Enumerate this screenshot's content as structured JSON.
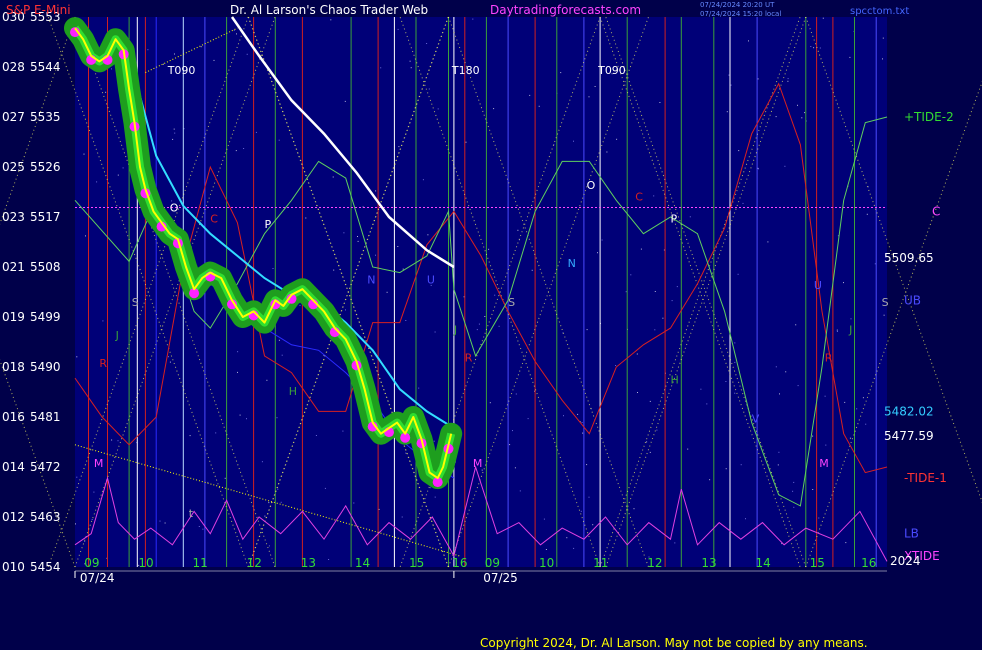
{
  "header": {
    "symbol": "S&P E-Mini",
    "title": "Dr. Al Larson's Chaos Trader Web",
    "site": "Daytradingforecasts.com",
    "stamp_line1": "07/24/2024 20:20 UT",
    "stamp_line2": "07/24/2024 15:20 local",
    "file": "spcctom.txt"
  },
  "footer": {
    "copyright": "Copyright 2024, Dr. Al Larson. May not be copied by any means."
  },
  "colors": {
    "background": "#00004a",
    "plot": "#000078",
    "price": "#ffff00",
    "price_band": "#1e9e1e",
    "price_dots": "#ff22ff",
    "tide_green": "#5fd05f",
    "tide_red": "#d82020",
    "xtide": "#e040e0",
    "cyan_band": "#33ddff",
    "ref_line": "#ff44ff"
  },
  "chart_data": {
    "type": "line",
    "title": "Dr. Al Larson's Chaos Trader Web",
    "instrument": "S&P E-Mini",
    "ylim": [
      5454,
      5553
    ],
    "y_ticks": [
      {
        "left": "030",
        "price": "5553"
      },
      {
        "left": "028",
        "price": "5544"
      },
      {
        "left": "027",
        "price": "5535"
      },
      {
        "left": "025",
        "price": "5526"
      },
      {
        "left": "023",
        "price": "5517"
      },
      {
        "left": "021",
        "price": "5508"
      },
      {
        "left": "019",
        "price": "5499"
      },
      {
        "left": "018",
        "price": "5490"
      },
      {
        "left": "016",
        "price": "5481"
      },
      {
        "left": "014",
        "price": "5472"
      },
      {
        "left": "012",
        "price": "5463"
      },
      {
        "left": "010",
        "price": "5454"
      }
    ],
    "hour_ticks": [
      "09",
      "10",
      "11",
      "12",
      "13",
      "14",
      "15",
      "16",
      "09",
      "10",
      "11",
      "12",
      "13",
      "14",
      "15",
      "16"
    ],
    "date_labels": [
      "07/24",
      "07/25"
    ],
    "year_label": "2024",
    "right_values": [
      "5509.65",
      "5482.02",
      "5477.59"
    ],
    "right_labels": [
      "+TIDE-2",
      "C",
      "UB",
      "-TIDE-1",
      "LB",
      "XTIDE"
    ],
    "reference_line_value": 5518.7,
    "time_markers": [
      "T090",
      "T180",
      "T090"
    ],
    "letter_markers": [
      "O",
      "C",
      "P",
      "S",
      "J",
      "R",
      "H",
      "M",
      "t",
      "O",
      "C",
      "P",
      "N",
      "S",
      "J",
      "R",
      "H",
      "M",
      "S",
      "J",
      "R",
      "M",
      "U",
      "V",
      "N",
      "U"
    ],
    "price_series": [
      {
        "h": 9.0,
        "v": 5551
      },
      {
        "h": 9.15,
        "v": 5549
      },
      {
        "h": 9.3,
        "v": 5546
      },
      {
        "h": 9.45,
        "v": 5545
      },
      {
        "h": 9.6,
        "v": 5546
      },
      {
        "h": 9.75,
        "v": 5549
      },
      {
        "h": 9.9,
        "v": 5547
      },
      {
        "h": 10.0,
        "v": 5540
      },
      {
        "h": 10.1,
        "v": 5534
      },
      {
        "h": 10.2,
        "v": 5526
      },
      {
        "h": 10.3,
        "v": 5522
      },
      {
        "h": 10.45,
        "v": 5518
      },
      {
        "h": 10.6,
        "v": 5516
      },
      {
        "h": 10.75,
        "v": 5514
      },
      {
        "h": 10.9,
        "v": 5513
      },
      {
        "h": 11.05,
        "v": 5508
      },
      {
        "h": 11.2,
        "v": 5504
      },
      {
        "h": 11.35,
        "v": 5506
      },
      {
        "h": 11.5,
        "v": 5507
      },
      {
        "h": 11.7,
        "v": 5506
      },
      {
        "h": 11.9,
        "v": 5502
      },
      {
        "h": 12.1,
        "v": 5499
      },
      {
        "h": 12.3,
        "v": 5500
      },
      {
        "h": 12.5,
        "v": 5498
      },
      {
        "h": 12.7,
        "v": 5502
      },
      {
        "h": 12.85,
        "v": 5501
      },
      {
        "h": 13.0,
        "v": 5503
      },
      {
        "h": 13.2,
        "v": 5504
      },
      {
        "h": 13.4,
        "v": 5502
      },
      {
        "h": 13.6,
        "v": 5500
      },
      {
        "h": 13.8,
        "v": 5497
      },
      {
        "h": 14.0,
        "v": 5495
      },
      {
        "h": 14.2,
        "v": 5491
      },
      {
        "h": 14.35,
        "v": 5486
      },
      {
        "h": 14.5,
        "v": 5480
      },
      {
        "h": 14.65,
        "v": 5478
      },
      {
        "h": 14.8,
        "v": 5479
      },
      {
        "h": 14.95,
        "v": 5480
      },
      {
        "h": 15.1,
        "v": 5478
      },
      {
        "h": 15.25,
        "v": 5481
      },
      {
        "h": 15.4,
        "v": 5477
      },
      {
        "h": 15.55,
        "v": 5471
      },
      {
        "h": 15.7,
        "v": 5470
      },
      {
        "h": 15.8,
        "v": 5472
      },
      {
        "h": 15.9,
        "v": 5476
      },
      {
        "h": 15.95,
        "v": 5478
      }
    ],
    "tide_green_series": [
      {
        "h": 9.0,
        "v": 5520
      },
      {
        "h": 10.0,
        "v": 5509
      },
      {
        "h": 10.5,
        "v": 5520
      },
      {
        "h": 11.0,
        "v": 5506
      },
      {
        "h": 11.2,
        "v": 5500
      },
      {
        "h": 11.5,
        "v": 5497
      },
      {
        "h": 12.0,
        "v": 5505
      },
      {
        "h": 12.5,
        "v": 5514
      },
      {
        "h": 13.0,
        "v": 5520
      },
      {
        "h": 13.5,
        "v": 5527
      },
      {
        "h": 14.0,
        "v": 5524
      },
      {
        "h": 14.5,
        "v": 5508
      },
      {
        "h": 15.0,
        "v": 5507
      },
      {
        "h": 15.5,
        "v": 5510
      },
      {
        "h": 15.9,
        "v": 5518
      },
      {
        "h": 16.0,
        "v": 5504
      },
      {
        "h": 16.4,
        "v": 5492
      },
      {
        "h": 17.0,
        "v": 5502
      },
      {
        "h": 17.5,
        "v": 5518
      },
      {
        "h": 18.0,
        "v": 5527
      },
      {
        "h": 18.5,
        "v": 5527
      },
      {
        "h": 19.0,
        "v": 5520
      },
      {
        "h": 19.5,
        "v": 5514
      },
      {
        "h": 20.0,
        "v": 5517
      },
      {
        "h": 20.5,
        "v": 5514
      },
      {
        "h": 21.0,
        "v": 5500
      },
      {
        "h": 21.5,
        "v": 5480
      },
      {
        "h": 22.0,
        "v": 5467
      },
      {
        "h": 22.4,
        "v": 5465
      },
      {
        "h": 22.8,
        "v": 5490
      },
      {
        "h": 23.2,
        "v": 5520
      },
      {
        "h": 23.6,
        "v": 5534
      },
      {
        "h": 24.0,
        "v": 5535
      }
    ],
    "tide_red_series": [
      {
        "h": 9.0,
        "v": 5488
      },
      {
        "h": 9.5,
        "v": 5481
      },
      {
        "h": 10.0,
        "v": 5476
      },
      {
        "h": 10.5,
        "v": 5481
      },
      {
        "h": 11.0,
        "v": 5508
      },
      {
        "h": 11.5,
        "v": 5526
      },
      {
        "h": 12.0,
        "v": 5516
      },
      {
        "h": 12.5,
        "v": 5492
      },
      {
        "h": 13.0,
        "v": 5489
      },
      {
        "h": 13.5,
        "v": 5482
      },
      {
        "h": 14.0,
        "v": 5482
      },
      {
        "h": 14.5,
        "v": 5498
      },
      {
        "h": 15.0,
        "v": 5498
      },
      {
        "h": 15.5,
        "v": 5512
      },
      {
        "h": 16.0,
        "v": 5518
      },
      {
        "h": 16.5,
        "v": 5510
      },
      {
        "h": 17.0,
        "v": 5500
      },
      {
        "h": 17.5,
        "v": 5491
      },
      {
        "h": 18.0,
        "v": 5484
      },
      {
        "h": 18.5,
        "v": 5478
      },
      {
        "h": 19.0,
        "v": 5490
      },
      {
        "h": 19.5,
        "v": 5494
      },
      {
        "h": 20.0,
        "v": 5497
      },
      {
        "h": 20.5,
        "v": 5505
      },
      {
        "h": 21.0,
        "v": 5515
      },
      {
        "h": 21.5,
        "v": 5532
      },
      {
        "h": 22.0,
        "v": 5541
      },
      {
        "h": 22.4,
        "v": 5530
      },
      {
        "h": 22.8,
        "v": 5500
      },
      {
        "h": 23.2,
        "v": 5478
      },
      {
        "h": 23.6,
        "v": 5471
      },
      {
        "h": 24.0,
        "v": 5472
      }
    ],
    "xtide_series": [
      {
        "h": 9.0,
        "v": 5458
      },
      {
        "h": 9.3,
        "v": 5460
      },
      {
        "h": 9.6,
        "v": 5470
      },
      {
        "h": 9.8,
        "v": 5462
      },
      {
        "h": 10.1,
        "v": 5459
      },
      {
        "h": 10.4,
        "v": 5461
      },
      {
        "h": 10.8,
        "v": 5458
      },
      {
        "h": 11.2,
        "v": 5464
      },
      {
        "h": 11.5,
        "v": 5460
      },
      {
        "h": 11.8,
        "v": 5466
      },
      {
        "h": 12.1,
        "v": 5459
      },
      {
        "h": 12.4,
        "v": 5463
      },
      {
        "h": 12.8,
        "v": 5460
      },
      {
        "h": 13.2,
        "v": 5464
      },
      {
        "h": 13.6,
        "v": 5459
      },
      {
        "h": 14.0,
        "v": 5465
      },
      {
        "h": 14.4,
        "v": 5458
      },
      {
        "h": 14.8,
        "v": 5462
      },
      {
        "h": 15.2,
        "v": 5459
      },
      {
        "h": 15.6,
        "v": 5463
      },
      {
        "h": 16.0,
        "v": 5456
      },
      {
        "h": 16.4,
        "v": 5472
      },
      {
        "h": 16.8,
        "v": 5460
      },
      {
        "h": 17.2,
        "v": 5462
      },
      {
        "h": 17.6,
        "v": 5458
      },
      {
        "h": 18.0,
        "v": 5461
      },
      {
        "h": 18.4,
        "v": 5459
      },
      {
        "h": 18.8,
        "v": 5463
      },
      {
        "h": 19.2,
        "v": 5458
      },
      {
        "h": 19.6,
        "v": 5462
      },
      {
        "h": 20.0,
        "v": 5459
      },
      {
        "h": 20.2,
        "v": 5468
      },
      {
        "h": 20.5,
        "v": 5458
      },
      {
        "h": 20.9,
        "v": 5462
      },
      {
        "h": 21.3,
        "v": 5459
      },
      {
        "h": 21.7,
        "v": 5462
      },
      {
        "h": 22.1,
        "v": 5458
      },
      {
        "h": 22.5,
        "v": 5461
      },
      {
        "h": 23.0,
        "v": 5459
      },
      {
        "h": 23.5,
        "v": 5464
      },
      {
        "h": 24.0,
        "v": 5455
      }
    ],
    "cyan_series": [
      {
        "h": 10.0,
        "v": 5546
      },
      {
        "h": 10.5,
        "v": 5528
      },
      {
        "h": 11.0,
        "v": 5519
      },
      {
        "h": 11.5,
        "v": 5514
      },
      {
        "h": 12.0,
        "v": 5510
      },
      {
        "h": 12.5,
        "v": 5506
      },
      {
        "h": 13.0,
        "v": 5503
      },
      {
        "h": 13.5,
        "v": 5502
      },
      {
        "h": 14.0,
        "v": 5498
      },
      {
        "h": 14.5,
        "v": 5493
      },
      {
        "h": 15.0,
        "v": 5486
      },
      {
        "h": 15.5,
        "v": 5482
      },
      {
        "h": 16.0,
        "v": 5479
      }
    ],
    "white_series": [
      {
        "h": 11.9,
        "v": 5553
      },
      {
        "h": 12.4,
        "v": 5546
      },
      {
        "h": 13.0,
        "v": 5538
      },
      {
        "h": 13.6,
        "v": 5532
      },
      {
        "h": 14.2,
        "v": 5525
      },
      {
        "h": 14.8,
        "v": 5517
      },
      {
        "h": 15.5,
        "v": 5511
      },
      {
        "h": 16.0,
        "v": 5508
      }
    ]
  }
}
